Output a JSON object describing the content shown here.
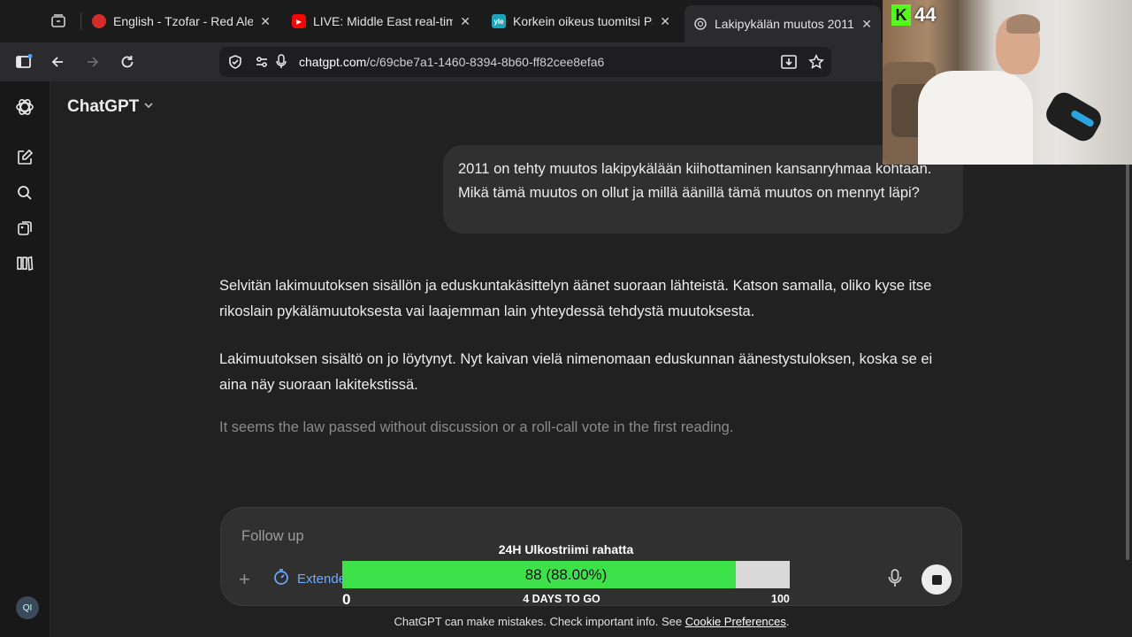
{
  "browser": {
    "tabs": [
      {
        "title": "English - Tzofar - Red Alert",
        "favicon": "red-alert-icon",
        "active": false
      },
      {
        "title": "LIVE: Middle East real-time c",
        "favicon": "youtube-icon",
        "active": false
      },
      {
        "title": "Korkein oikeus tuomitsi Päiv",
        "favicon": "yle-icon",
        "active": false
      },
      {
        "title": "Lakipykälän muutos 2011",
        "favicon": "chatgpt-icon",
        "active": true
      }
    ],
    "url_domain": "chatgpt.com",
    "url_path": "/c/69cbe7a1-1460-8394-8b60-ff82cee8efa6"
  },
  "app": {
    "brand": "ChatGPT",
    "avatar_initials": "QI"
  },
  "chat": {
    "user_message": "2011 on tehty muutos lakipykälään kiihottaminen kansanryhmaa kohtaan. Mikä tämä muutos on ollut ja millä äänillä tämä muutos on mennyt läpi?",
    "assistant_para1": "Selvitän lakimuutoksen sisällön ja eduskuntakäsittelyn äänet suoraan lähteistä. Katson samalla, oliko kyse itse rikoslain pykälämuutoksesta vai laajemman lain yhteydessä tehdystä muutoksesta.",
    "assistant_para2": "Lakimuutoksen sisältö on jo löytynyt. Nyt kaivan vielä nimenomaan eduskunnan äänestystuloksen, koska se ei aina näy suoraan lakitekstissä.",
    "thinking": "It seems the law passed without discussion or a roll-call vote in the first reading."
  },
  "composer": {
    "placeholder": "Follow up",
    "mode_label": "Extended"
  },
  "overlay": {
    "goal_title": "24H Ulkostriimi rahatta",
    "goal_value_text": "88 (88.00%)",
    "goal_progress_fraction": 0.88,
    "goal_min": "0",
    "goal_max": "100",
    "goal_days": "4 DAYS TO GO",
    "webcam_badge": "44",
    "webcam_badge_letter": "K"
  },
  "footer": {
    "disclaimer": "ChatGPT can make mistakes. Check important info. See",
    "link": "Cookie Preferences",
    "end": "."
  },
  "colors": {
    "accent_blue": "#6ea8ff",
    "progress_green": "#3de24a",
    "kick_green": "#53fc18"
  }
}
